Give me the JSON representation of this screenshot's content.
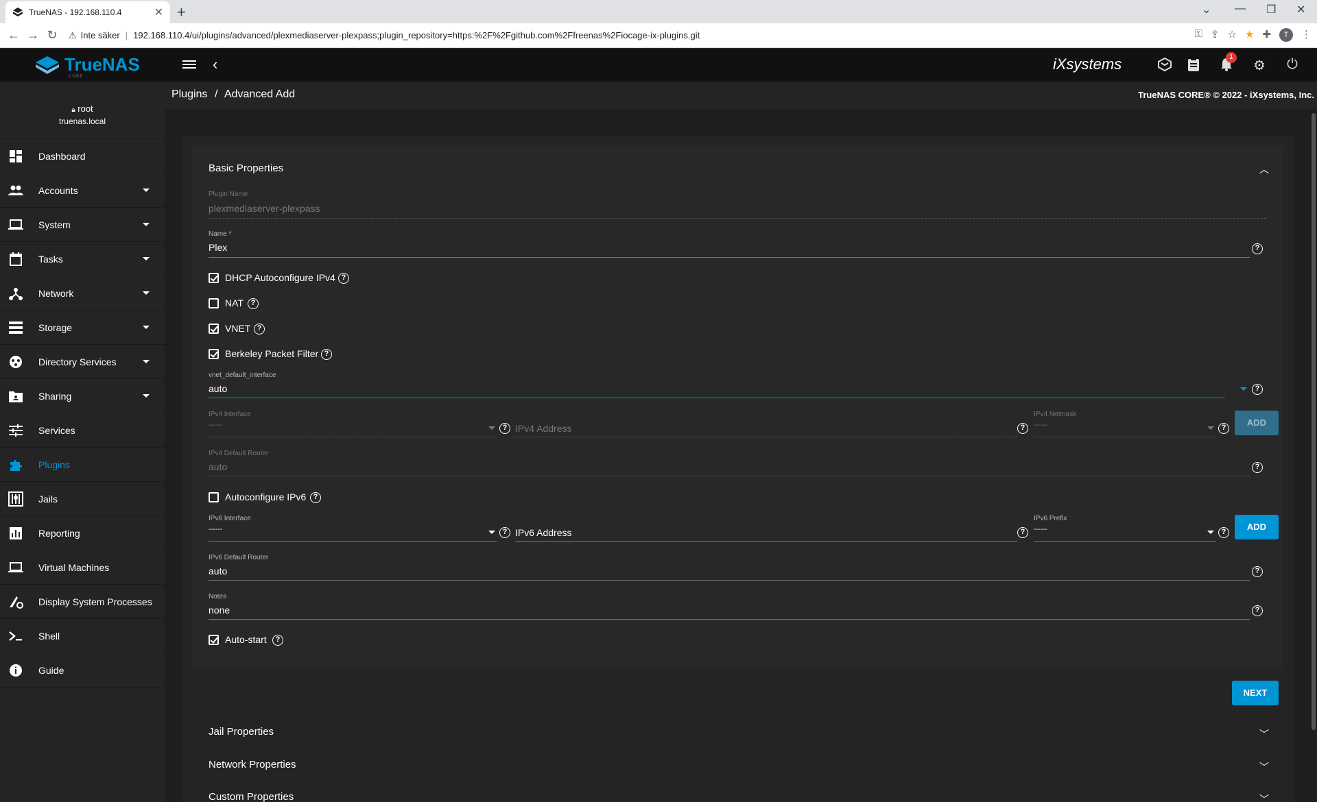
{
  "browser": {
    "tab_title": "TrueNAS - 192.168.110.4",
    "security_label": "Inte säker",
    "url": "192.168.110.4/ui/plugins/advanced/plexmediaserver-plexpass;plugin_repository=https:%2F%2Fgithub.com%2Ffreenas%2Fiocage-ix-plugins.git",
    "profile_initial": "T"
  },
  "header": {
    "logo_text": "TrueNAS",
    "logo_sub": "CORE",
    "brand_right": "iXsystems",
    "notification_count": "1"
  },
  "breadcrumb": {
    "parent": "Plugins",
    "separator": "/",
    "current": "Advanced Add"
  },
  "copyright": "TrueNAS CORE® © 2022 - iXsystems, Inc.",
  "user": {
    "name": "root",
    "host": "truenas.local"
  },
  "sidebar": {
    "items": [
      {
        "label": "Dashboard",
        "icon": "dashboard-icon",
        "expandable": false
      },
      {
        "label": "Accounts",
        "icon": "accounts-icon",
        "expandable": true
      },
      {
        "label": "System",
        "icon": "laptop-icon",
        "expandable": true
      },
      {
        "label": "Tasks",
        "icon": "calendar-icon",
        "expandable": true
      },
      {
        "label": "Network",
        "icon": "network-icon",
        "expandable": true
      },
      {
        "label": "Storage",
        "icon": "storage-icon",
        "expandable": true
      },
      {
        "label": "Directory Services",
        "icon": "directory-icon",
        "expandable": true
      },
      {
        "label": "Sharing",
        "icon": "sharing-icon",
        "expandable": true
      },
      {
        "label": "Services",
        "icon": "tune-icon",
        "expandable": false
      },
      {
        "label": "Plugins",
        "icon": "puzzle-icon",
        "expandable": false,
        "active": true
      },
      {
        "label": "Jails",
        "icon": "jail-icon",
        "expandable": false
      },
      {
        "label": "Reporting",
        "icon": "chart-icon",
        "expandable": false
      },
      {
        "label": "Virtual Machines",
        "icon": "monitor-icon",
        "expandable": false
      },
      {
        "label": "Display System Processes",
        "icon": "processes-icon",
        "expandable": false
      },
      {
        "label": "Shell",
        "icon": "terminal-icon",
        "expandable": false
      },
      {
        "label": "Guide",
        "icon": "info-icon",
        "expandable": false
      }
    ]
  },
  "form": {
    "section_title": "Basic Properties",
    "plugin_name_label": "Plugin Name",
    "plugin_name_value": "plexmediaserver-plexpass",
    "name_label": "Name *",
    "name_value": "Plex",
    "dhcp_label": "DHCP Autoconfigure IPv4",
    "dhcp_checked": true,
    "nat_label": "NAT",
    "nat_checked": false,
    "vnet_label": "VNET",
    "vnet_checked": true,
    "bpf_label": "Berkeley Packet Filter",
    "bpf_checked": true,
    "vnet_iface_label": "vnet_default_interface",
    "vnet_iface_value": "auto",
    "ipv4_iface_label": "IPv4 Interface",
    "ipv4_iface_value": "------",
    "ipv4_addr_placeholder": "IPv4 Address",
    "ipv4_netmask_label": "IPv4 Netmask",
    "ipv4_netmask_value": "------",
    "ipv4_add": "ADD",
    "ipv4_router_label": "IPv4 Default Router",
    "ipv4_router_value": "auto",
    "autoipv6_label": "Autoconfigure IPv6",
    "autoipv6_checked": false,
    "ipv6_iface_label": "IPv6 Interface",
    "ipv6_iface_value": "------",
    "ipv6_addr_placeholder": "IPv6 Address",
    "ipv6_prefix_label": "IPv6 Prefix",
    "ipv6_prefix_value": "------",
    "ipv6_add": "ADD",
    "ipv6_router_label": "IPv6 Default Router",
    "ipv6_router_value": "auto",
    "notes_label": "Notes",
    "notes_value": "none",
    "autostart_label": "Auto-start",
    "autostart_checked": true,
    "next": "NEXT"
  },
  "sections": [
    "Jail Properties",
    "Network Properties",
    "Custom Properties"
  ],
  "colors": {
    "accent": "#0095d5",
    "topbar": "#111111",
    "sidebar": "#242424",
    "panel": "#282828"
  }
}
